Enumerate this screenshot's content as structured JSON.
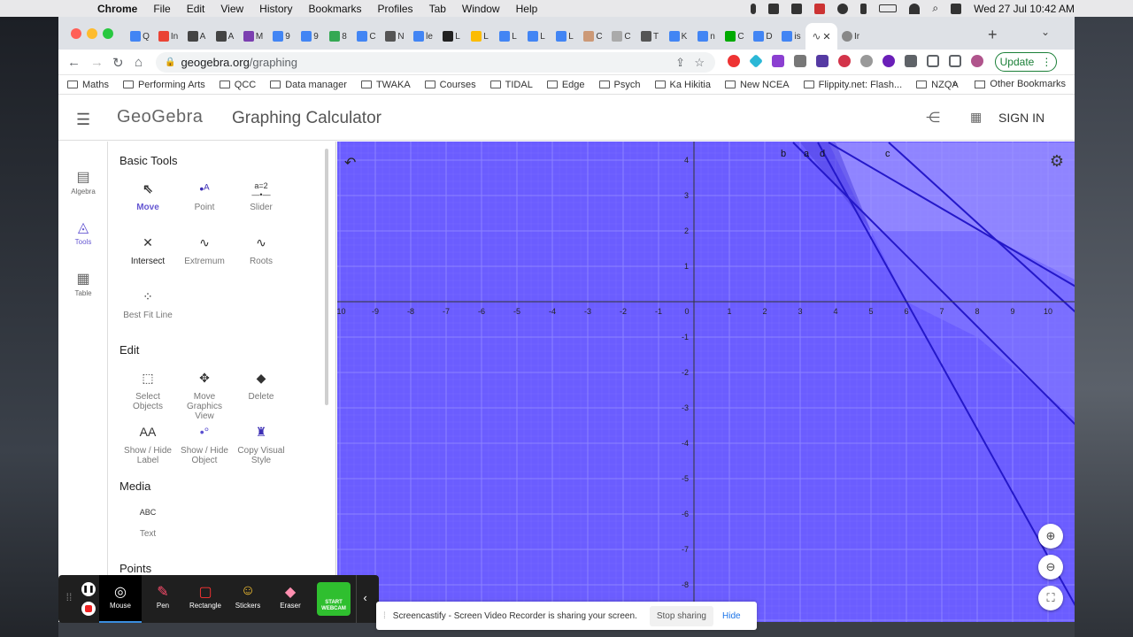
{
  "menubar": {
    "app": "Chrome",
    "items": [
      "File",
      "Edit",
      "View",
      "History",
      "Bookmarks",
      "Profiles",
      "Tab",
      "Window",
      "Help"
    ],
    "datetime": "Wed 27 Jul  10:42 AM"
  },
  "tabs": [
    {
      "letter": "Q",
      "color": "#4285f4"
    },
    {
      "letter": "In",
      "color": "#ea4335"
    },
    {
      "letter": "A",
      "color": "#444"
    },
    {
      "letter": "A",
      "color": "#444"
    },
    {
      "letter": "M",
      "color": "#7b3fb0"
    },
    {
      "letter": "9",
      "color": "#4285f4"
    },
    {
      "letter": "9",
      "color": "#4285f4"
    },
    {
      "letter": "8",
      "color": "#34a853"
    },
    {
      "letter": "C",
      "color": "#4285f4"
    },
    {
      "letter": "N",
      "color": "#555"
    },
    {
      "letter": "le",
      "color": "#4285f4"
    },
    {
      "letter": "L",
      "color": "#222"
    },
    {
      "letter": "L",
      "color": "#fbbc04"
    },
    {
      "letter": "L",
      "color": "#4285f4"
    },
    {
      "letter": "L",
      "color": "#4285f4"
    },
    {
      "letter": "L",
      "color": "#4285f4"
    },
    {
      "letter": "C",
      "color": "#c97"
    },
    {
      "letter": "C",
      "color": "#aaa"
    },
    {
      "letter": "T",
      "color": "#555"
    },
    {
      "letter": "K",
      "color": "#4285f4"
    },
    {
      "letter": "n",
      "color": "#4285f4"
    },
    {
      "letter": "C",
      "color": "#0a0"
    },
    {
      "letter": "D",
      "color": "#4285f4"
    },
    {
      "letter": "is",
      "color": "#4285f4"
    }
  ],
  "active_tab_icon": "geogebra-icon",
  "extra_tab": "Ir",
  "address": {
    "domain": "geogebra.org",
    "path": "/graphing"
  },
  "update_label": "Update",
  "bookmarks": [
    {
      "label": "Maths"
    },
    {
      "label": "Performing Arts"
    },
    {
      "label": "QCC"
    },
    {
      "label": "Data manager"
    },
    {
      "label": "TWAKA"
    },
    {
      "label": "Courses"
    },
    {
      "label": "TIDAL"
    },
    {
      "label": "Edge"
    },
    {
      "label": "Psych"
    },
    {
      "label": "Ka Hikitia"
    },
    {
      "label": "New NCEA"
    },
    {
      "label": "Flippity.net: Flash..."
    },
    {
      "label": "NZQA"
    }
  ],
  "bookmarks_more": "»",
  "other_bookmarks": "Other Bookmarks",
  "geogebra": {
    "logo": "GeoGebra",
    "title": "Graphing Calculator",
    "signin": "SIGN IN"
  },
  "rail": [
    {
      "label": "Algebra",
      "icon": "calculator-icon"
    },
    {
      "label": "Tools",
      "icon": "tools-icon"
    },
    {
      "label": "Table",
      "icon": "table-icon"
    }
  ],
  "tools": {
    "basic_title": "Basic Tools",
    "basic": [
      {
        "label": "Move",
        "icon": "cursor-icon"
      },
      {
        "label": "Point",
        "icon": "point-icon"
      },
      {
        "label": "Slider",
        "icon": "slider-icon"
      },
      {
        "label": "Intersect",
        "icon": "intersect-icon"
      },
      {
        "label": "Extremum",
        "icon": "extremum-icon"
      },
      {
        "label": "Roots",
        "icon": "roots-icon"
      },
      {
        "label": "Best Fit Line",
        "icon": "best-fit-icon"
      }
    ],
    "edit_title": "Edit",
    "edit": [
      {
        "label": "Select Objects",
        "icon": "select-icon"
      },
      {
        "label": "Move Graphics View",
        "icon": "move-view-icon"
      },
      {
        "label": "Delete",
        "icon": "eraser-icon"
      },
      {
        "label": "Show / Hide Label",
        "icon": "label-icon"
      },
      {
        "label": "Show / Hide Object",
        "icon": "object-icon"
      },
      {
        "label": "Copy Visual Style",
        "icon": "brush-icon"
      }
    ],
    "media_title": "Media",
    "media": [
      {
        "label": "Text",
        "icon": "text-icon",
        "glyph": "ABC"
      }
    ],
    "points_title": "Points"
  },
  "graph": {
    "x_ticks": [
      "-10",
      "-9",
      "-8",
      "-7",
      "-6",
      "-5",
      "-4",
      "-3",
      "-2",
      "-1",
      "0",
      "1",
      "2",
      "3",
      "4",
      "5",
      "6",
      "7",
      "8",
      "9",
      "10"
    ],
    "y_ticks": [
      "4",
      "3",
      "2",
      "1",
      "-1",
      "-2",
      "-3",
      "-4",
      "-5",
      "-6",
      "-7",
      "-8"
    ],
    "line_labels": [
      "b",
      "a",
      "d",
      "c"
    ],
    "background": "#6b5dff"
  },
  "screencastify": {
    "buttons": [
      {
        "label": "Mouse",
        "icon": "mouse-icon"
      },
      {
        "label": "Pen",
        "icon": "pen-icon"
      },
      {
        "label": "Rectangle",
        "icon": "rectangle-icon"
      },
      {
        "label": "Stickers",
        "icon": "sticker-icon"
      },
      {
        "label": "Eraser",
        "icon": "eraser-icon"
      }
    ],
    "webcam": "START WEBCAM",
    "share_message": "Screencastify - Screen Video Recorder is sharing your screen.",
    "stop_label": "Stop sharing",
    "hide_label": "Hide"
  }
}
